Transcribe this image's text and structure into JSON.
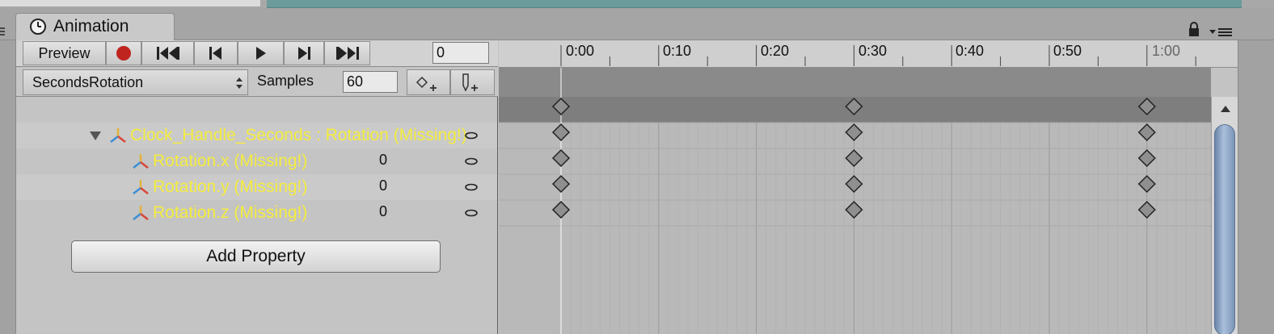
{
  "window": {
    "tab_title": "Animation",
    "icons": [
      "clock-icon",
      "lock-icon",
      "menu-icon"
    ]
  },
  "toolbar": {
    "preview_label": "Preview",
    "record_color": "#c0241f",
    "frame_value": "0"
  },
  "clip": {
    "name": "SecondsRotation",
    "samples_label": "Samples",
    "samples_value": "60"
  },
  "hierarchy": {
    "group_label": "Clock_Handle_Seconds : Rotation (Missing!)",
    "properties": [
      {
        "label": "Rotation.x (Missing!)",
        "value": "0"
      },
      {
        "label": "Rotation.y (Missing!)",
        "value": "0"
      },
      {
        "label": "Rotation.z (Missing!)",
        "value": "0"
      }
    ],
    "add_property_label": "Add Property",
    "missing_color": "#f4ec3f"
  },
  "timeline": {
    "ticks": [
      "0:00",
      "0:10",
      "0:20",
      "0:30",
      "0:40",
      "0:50",
      "1:00"
    ],
    "key_times": [
      "0:00",
      "0:30",
      "1:00"
    ]
  }
}
